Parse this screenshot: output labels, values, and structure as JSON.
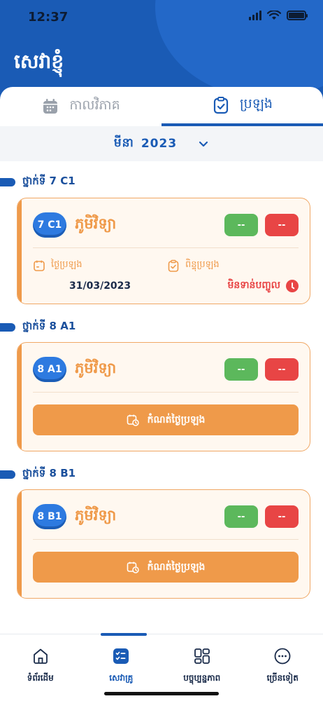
{
  "status_bar": {
    "time": "12:37"
  },
  "header": {
    "title": "សេវាខ្ញុំ"
  },
  "tabs": [
    {
      "label": "កាលវិភាគ",
      "active": false,
      "icon": "calendar-icon"
    },
    {
      "label": "ប្រឡង",
      "active": true,
      "icon": "clipboard-check-icon"
    }
  ],
  "month_selector": {
    "month": "មីនា",
    "year": "2023"
  },
  "sections": [
    {
      "class_label": "ថ្នាក់ទី 7 C1",
      "badge": "7 C1",
      "subject": "ភូមិវិទ្យា",
      "score_green": "--",
      "score_red": "--",
      "exam_date_label": "ថ្ងៃប្រឡង",
      "exam_date": "31/03/2023",
      "exam_score_label": "ពិន្ទុប្រឡង",
      "status": "មិនទាន់បញ្ចូល"
    },
    {
      "class_label": "ថ្នាក់ទី 8 A1",
      "badge": "8 A1",
      "subject": "ភូមិវិទ្យា",
      "score_green": "--",
      "score_red": "--",
      "action_label": "កំណត់ថ្ងៃប្រឡង"
    },
    {
      "class_label": "ថ្នាក់ទី 8 B1",
      "badge": "8 B1",
      "subject": "ភូមិវិទ្យា",
      "score_green": "--",
      "score_red": "--",
      "action_label": "កំណត់ថ្ងៃប្រឡង"
    }
  ],
  "bottom_nav": [
    {
      "label": "ទំព័រដើម",
      "icon": "home-icon",
      "active": false
    },
    {
      "label": "សេវាគ្រូ",
      "icon": "checklist-icon",
      "active": true
    },
    {
      "label": "បច្ចុប្បន្នភាព",
      "icon": "grid-icon",
      "active": false
    },
    {
      "label": "ច្រើនទៀត",
      "icon": "more-icon",
      "active": false
    }
  ],
  "colors": {
    "primary": "#1a5bb5",
    "accent_orange": "#ef9a4a",
    "green": "#5cb85c",
    "red": "#e84545"
  }
}
